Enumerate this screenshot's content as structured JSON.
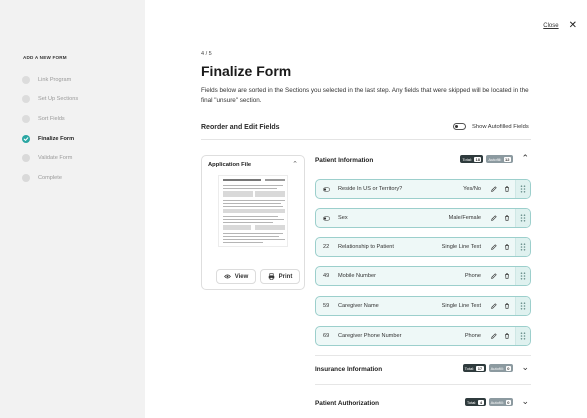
{
  "sidebar": {
    "heading": "ADD A NEW FORM",
    "steps": [
      {
        "label": "Link Program",
        "state": "done"
      },
      {
        "label": "Set Up Sections",
        "state": "done"
      },
      {
        "label": "Sort Fields",
        "state": "done"
      },
      {
        "label": "Finalize Form",
        "state": "active"
      },
      {
        "label": "Validate Form",
        "state": "pending"
      },
      {
        "label": "Complete",
        "state": "pending"
      }
    ]
  },
  "top": {
    "close_label": "Close",
    "close_icon": "close-icon"
  },
  "main": {
    "step_count": "4 / 5",
    "title": "Finalize Form",
    "description": "Fields below are sorted in the Sections you selected in the last step. Any fields that were skipped will be located in the final \"unsure\" section.",
    "section_title": "Reorder and Edit Fields",
    "toggle_label": "Show Autofilled Fields",
    "toggle_on": false
  },
  "app_file": {
    "title": "Application File",
    "view_label": "View",
    "print_label": "Print"
  },
  "panels": [
    {
      "name": "Patient Information",
      "total_label": "Total:",
      "total": "18",
      "autofill_label": "Autofill:",
      "autofill": "12",
      "expanded": true,
      "fields": [
        {
          "num": "",
          "icon": "toggle-icon",
          "name": "Reside In US or Territory?",
          "type": "Yes/No"
        },
        {
          "num": "",
          "icon": "toggle-icon",
          "name": "Sex",
          "type": "Male/Female"
        },
        {
          "num": "22",
          "name": "Relationship to Patient",
          "type": "Single Line Text"
        },
        {
          "num": "49",
          "name": "Mobile Number",
          "type": "Phone"
        },
        {
          "num": "59",
          "name": "Caregiver Name",
          "type": "Single Line Text"
        },
        {
          "num": "69",
          "name": "Caregiver Phone Number",
          "type": "Phone"
        }
      ]
    },
    {
      "name": "Insurance Information",
      "total_label": "Total:",
      "total": "17",
      "autofill_label": "Autofill:",
      "autofill": "0",
      "expanded": false
    },
    {
      "name": "Patient Authorization",
      "total_label": "Total:",
      "total": "4",
      "autofill_label": "Autofill:",
      "autofill": "0",
      "expanded": false
    }
  ],
  "colors": {
    "accent": "#2aa6a2",
    "field_bg": "#eef8f7",
    "field_border": "#9ccfcc",
    "sidebar_bg": "#f2f2f2"
  }
}
